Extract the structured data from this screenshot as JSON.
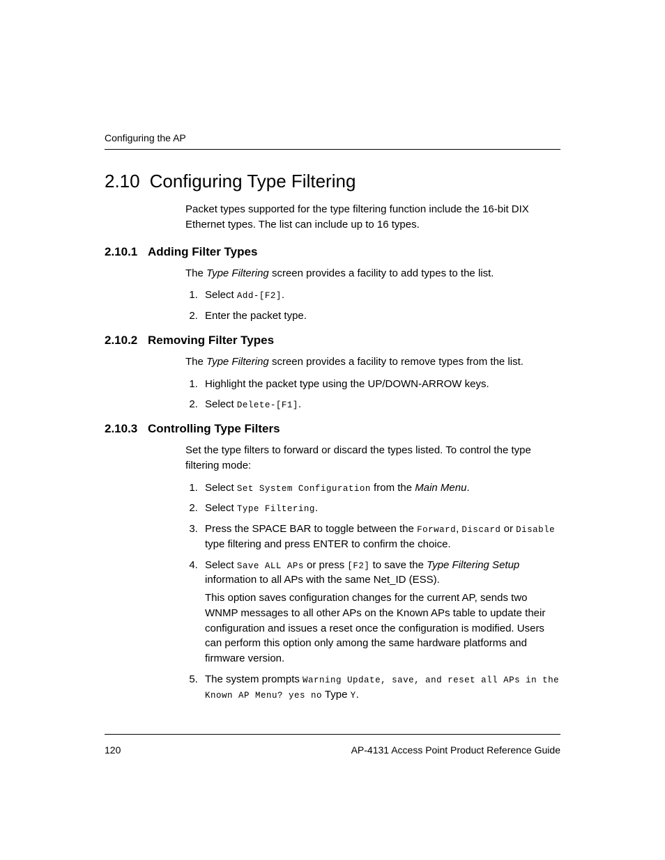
{
  "header": {
    "running_head": "Configuring the AP"
  },
  "section": {
    "number": "2.10",
    "title": "Configuring Type Filtering",
    "intro": "Packet types supported for the type filtering function include the 16-bit DIX Ethernet types. The list can include up to 16 types."
  },
  "sub1": {
    "number": "2.10.1",
    "title": "Adding Filter Types",
    "intro_pre": "The ",
    "intro_ital": "Type Filtering",
    "intro_post": " screen provides a facility to add types to the list.",
    "step1_pre": "Select ",
    "step1_mono": "Add-[F2]",
    "step1_post": ".",
    "step2": "Enter the packet type."
  },
  "sub2": {
    "number": "2.10.2",
    "title": "Removing Filter Types",
    "intro_pre": "The ",
    "intro_ital": "Type Filtering",
    "intro_post": " screen provides a facility to remove types from the list.",
    "step1": "Highlight the packet type using the UP/DOWN-ARROW keys.",
    "step2_pre": "Select ",
    "step2_mono": "Delete-[F1]",
    "step2_post": "."
  },
  "sub3": {
    "number": "2.10.3",
    "title": "Controlling Type Filters",
    "intro": "Set the type filters to forward or discard the types listed. To control the type filtering mode:",
    "step1_pre": "Select ",
    "step1_mono": "Set System Configuration",
    "step1_mid": " from the ",
    "step1_ital": "Main Menu",
    "step1_post": ".",
    "step2_pre": "Select ",
    "step2_mono": "Type Filtering",
    "step2_post": ".",
    "step3_pre": "Press the SPACE BAR to toggle between the ",
    "step3_m1": "Forward",
    "step3_c1": ", ",
    "step3_m2": "Discard",
    "step3_or": " or ",
    "step3_m3": "Disable",
    "step3_post": " type filtering and press ENTER to confirm the choice.",
    "step4_pre": "Select ",
    "step4_m1": "Save ALL APs",
    "step4_mid1": " or press ",
    "step4_m2": "[F2]",
    "step4_mid2": " to save the ",
    "step4_ital": "Type Filtering Setup",
    "step4_post1": " information to all APs with the same Net_ID (ESS).",
    "step4_extra": "This option saves configuration changes for the current AP, sends two WNMP messages to all other APs on the Known APs table to update their configuration and issues a reset once the configuration is modified. Users can perform this option only among the same hardware platforms and firmware version.",
    "step5_pre": "The system prompts ",
    "step5_m1": "Warning Update, save, and reset all APs in the Known AP Menu? yes no",
    "step5_mid": " Type ",
    "step5_m2": "Y",
    "step5_post": "."
  },
  "footer": {
    "page_number": "120",
    "doc_title": "AP-4131 Access Point Product Reference Guide"
  }
}
